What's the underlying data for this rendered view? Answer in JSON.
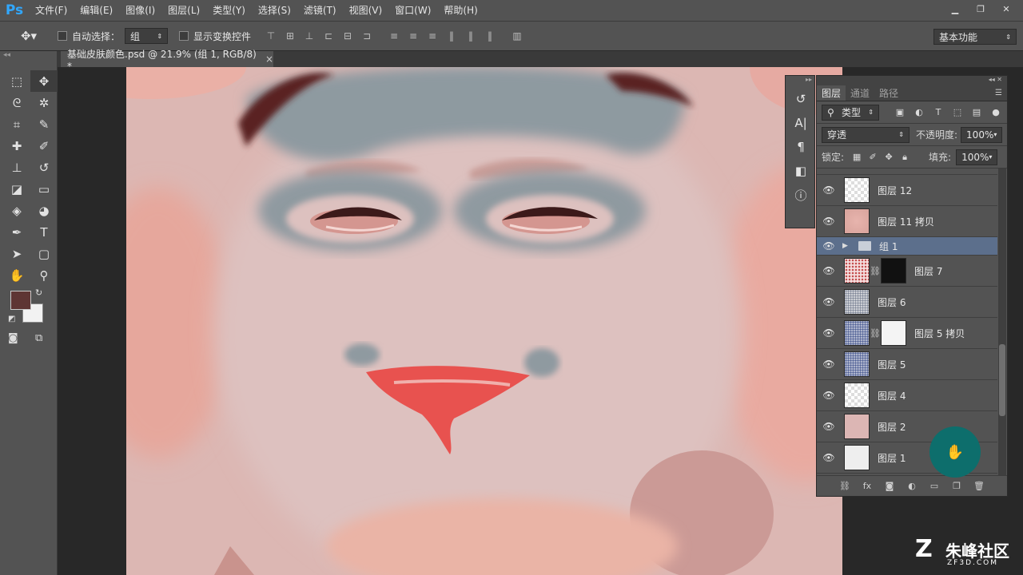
{
  "app": {
    "logo": "Ps"
  },
  "menu": [
    "文件(F)",
    "编辑(E)",
    "图像(I)",
    "图层(L)",
    "类型(Y)",
    "选择(S)",
    "滤镜(T)",
    "视图(V)",
    "窗口(W)",
    "帮助(H)"
  ],
  "options": {
    "auto_select_label": "自动选择：",
    "auto_select_value": "组",
    "show_transform_label": "显示变换控件",
    "workspace": "基本功能"
  },
  "document": {
    "tab_title": "基础皮肤颜色.psd @ 21.9% (组 1, RGB/8) *",
    "close": "×"
  },
  "panels": {
    "tabs": [
      "图层",
      "通道",
      "路径"
    ],
    "filter_kind": "类型",
    "blend_mode": "穿透",
    "opacity_label": "不透明度:",
    "opacity_value": "100%",
    "lock_label": "锁定:",
    "fill_label": "填充:",
    "fill_value": "100%"
  },
  "layers": [
    {
      "name": "图层 12",
      "thumb": "checker"
    },
    {
      "name": "图层 11 拷贝",
      "thumb": "face"
    },
    {
      "name": "组 1",
      "type": "group",
      "selected": true
    },
    {
      "name": "图层 7",
      "thumb": "speckle-red",
      "mask": "black"
    },
    {
      "name": "图层 6",
      "thumb": "speckle-gray"
    },
    {
      "name": "图层 5 拷贝",
      "thumb": "speckle-blue",
      "mask": "white"
    },
    {
      "name": "图层 5",
      "thumb": "speckle-blue"
    },
    {
      "name": "图层 4",
      "thumb": "checker"
    },
    {
      "name": "图层 2",
      "thumb": "pink"
    },
    {
      "name": "图层 1",
      "thumb": "white"
    }
  ],
  "drag_ghost": "组 1",
  "watermark": {
    "title": "朱峰社区",
    "url": "ZF3D.COM"
  },
  "colors": {
    "foreground": "#5e3534",
    "background": "#f2f2f2",
    "selection": "#5c6f8c"
  }
}
